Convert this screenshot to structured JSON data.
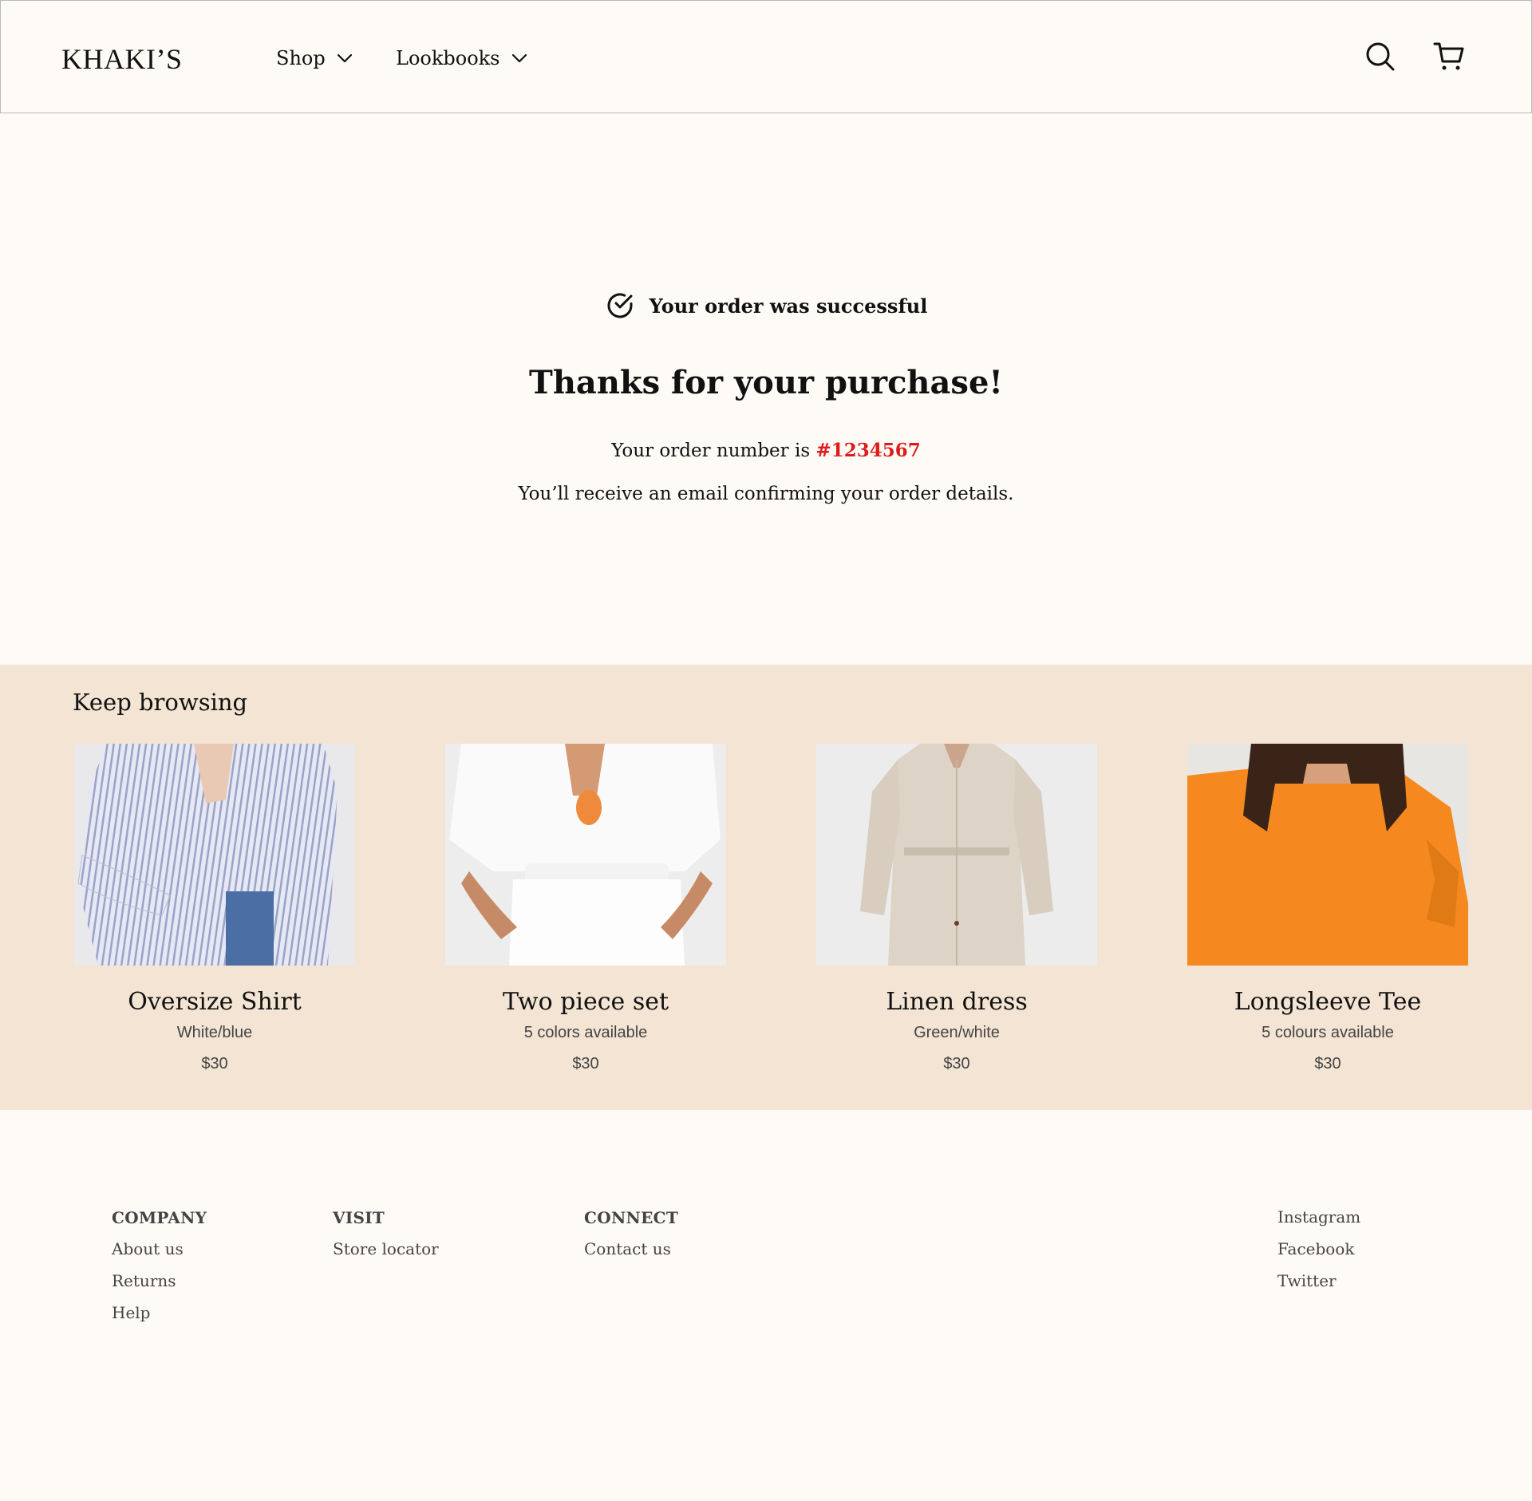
{
  "header": {
    "logo": "KHAKI’S",
    "nav": [
      {
        "label": "Shop"
      },
      {
        "label": "Lookbooks"
      }
    ],
    "icons": [
      "search-icon",
      "cart-icon"
    ]
  },
  "confirmation": {
    "status": "Your order was successful",
    "heading": "Thanks for your purchase!",
    "order_prefix": "Your order number is ",
    "order_number": "#1234567",
    "email_note": "You’ll receive an email confirming your order details.",
    "accent_color": "#e01b1b"
  },
  "browse": {
    "title": "Keep browsing",
    "products": [
      {
        "name": "Oversize Shirt",
        "sub": "White/blue",
        "price": "$30",
        "image": "striped-shirt-photo"
      },
      {
        "name": "Two piece set",
        "sub": "5 colors available",
        "price": "$30",
        "image": "white-two-piece-photo"
      },
      {
        "name": "Linen dress",
        "sub": "Green/white",
        "price": "$30",
        "image": "linen-dress-photo"
      },
      {
        "name": "Longsleeve Tee",
        "sub": "5 colours available",
        "price": "$30",
        "image": "orange-longsleeve-photo"
      }
    ],
    "background": "#f3e4d4"
  },
  "footer": {
    "columns": [
      {
        "heading": "COMPANY",
        "links": [
          "About us",
          "Returns",
          "Help"
        ]
      },
      {
        "heading": "VISIT",
        "links": [
          "Store locator"
        ]
      },
      {
        "heading": "CONNECT",
        "links": [
          "Contact us"
        ]
      },
      {
        "heading": "",
        "links": [
          "Instagram",
          "Facebook",
          "Twitter"
        ]
      }
    ]
  }
}
